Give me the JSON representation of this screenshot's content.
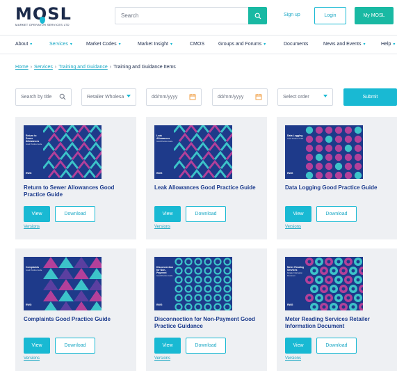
{
  "header": {
    "logo_text": "MOSL",
    "logo_subtitle": "MARKET OPERATOR SERVICES LTD",
    "search_placeholder": "Search",
    "signup_label": "Sign up",
    "login_label": "Login",
    "mymosl_label": "My MOSL"
  },
  "nav": {
    "items": [
      {
        "label": "About",
        "has_menu": true
      },
      {
        "label": "Services",
        "has_menu": true,
        "active": true
      },
      {
        "label": "Market Codes",
        "has_menu": true
      },
      {
        "label": "Market Insight",
        "has_menu": true
      },
      {
        "label": "CMOS",
        "has_menu": false
      },
      {
        "label": "Groups and Forums",
        "has_menu": true
      },
      {
        "label": "Documents",
        "has_menu": false
      },
      {
        "label": "News and Events",
        "has_menu": true
      },
      {
        "label": "Help",
        "has_menu": true
      }
    ]
  },
  "breadcrumb": {
    "home": "Home",
    "services": "Services",
    "training": "Training and Guidance",
    "current": "Training and Guidance Items"
  },
  "filters": {
    "search_placeholder": "Search by title",
    "retailer_select": "Retailer Wholesa",
    "date_from_placeholder": "dd/mm/yyyy",
    "date_to_placeholder": "dd/mm/yyyy",
    "order_select": "Select order",
    "submit_label": "Submit"
  },
  "cards": [
    {
      "title": "Return to Sewer Allowances Good Practice Guide",
      "cover_title": "Return to Sewer Allowances",
      "cover_subtitle": "Good Practice Guide",
      "cover_brand": "RWG",
      "pattern": "chevrons",
      "view_label": "View",
      "download_label": "Download",
      "versions_label": "Versions"
    },
    {
      "title": "Leak Allowances Good Practice Guide",
      "cover_title": "Leak Allowances",
      "cover_subtitle": "Good Practice Guide",
      "cover_brand": "RWG",
      "pattern": "chevrons",
      "view_label": "View",
      "download_label": "Download",
      "versions_label": "Versions"
    },
    {
      "title": "Data Logging Good Practice Guide",
      "cover_title": "Data Logging",
      "cover_subtitle": "Good Practice Guide",
      "cover_brand": "RWG",
      "pattern": "dots",
      "view_label": "View",
      "download_label": "Download",
      "versions_label": "Versions"
    },
    {
      "title": "Complaints Good Practice Guide",
      "cover_title": "Complaints",
      "cover_subtitle": "Good Practice Guide",
      "cover_brand": "RWG",
      "pattern": "arrows",
      "view_label": "View",
      "download_label": "Download",
      "versions_label": "Versions"
    },
    {
      "title": "Disconnection for Non-Payment Good Practice Guidance",
      "cover_title": "Disconnection for Non-Payment",
      "cover_subtitle": "Good Practice Guide",
      "cover_brand": "RWG",
      "pattern": "rings",
      "view_label": "View",
      "download_label": "Download",
      "versions_label": "Versions"
    },
    {
      "title": "Meter Reading Services Retailer Information Document",
      "cover_title": "Meter Reading Services",
      "cover_subtitle": "Retailer Information Document",
      "cover_brand": "RWG",
      "pattern": "hex",
      "view_label": "View",
      "download_label": "Download",
      "versions_label": "Versions"
    }
  ],
  "colors": {
    "accent": "#19b9d3",
    "teal": "#19b9a3",
    "navy": "#1e3a8a",
    "magenta": "#b3409a",
    "cyan": "#3cc3c9",
    "card_bg": "#eef0f3"
  }
}
